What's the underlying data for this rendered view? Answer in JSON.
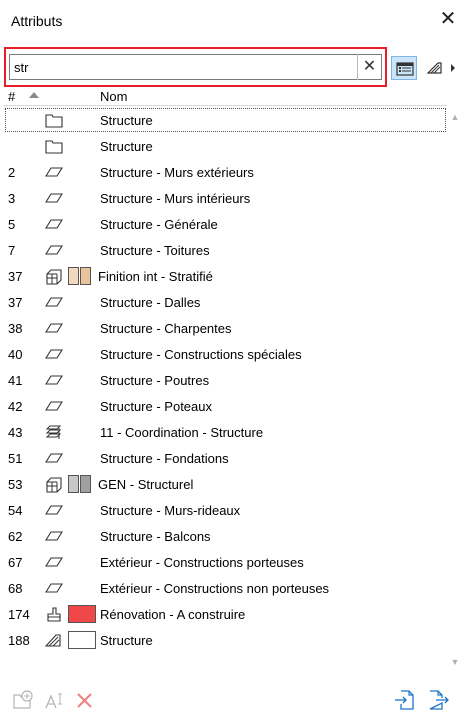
{
  "window": {
    "title": "Attributs",
    "close_icon": "close-icon"
  },
  "search": {
    "value": "str",
    "placeholder": "",
    "clear_icon": "clear-icon"
  },
  "toolbar": {
    "buttons": [
      {
        "icon": "list-view-icon",
        "active": true
      },
      {
        "icon": "attribute-type-icon",
        "active": false
      }
    ]
  },
  "header": {
    "num_label": "#",
    "name_label": "Nom",
    "sort": "ascending"
  },
  "rows": [
    {
      "num": "",
      "icon": "folder-icon",
      "name": "Structure",
      "selected": true
    },
    {
      "num": "",
      "icon": "folder-icon",
      "name": "Structure"
    },
    {
      "num": "2",
      "icon": "layer-icon",
      "name": "Structure - Murs extérieurs"
    },
    {
      "num": "3",
      "icon": "layer-icon",
      "name": "Structure - Murs intérieurs"
    },
    {
      "num": "5",
      "icon": "layer-icon",
      "name": "Structure - Générale"
    },
    {
      "num": "7",
      "icon": "layer-icon",
      "name": "Structure - Toitures"
    },
    {
      "num": "37",
      "icon": "composite-icon",
      "name": "Finition int - Stratifié",
      "swatches": [
        "#f2d9bd",
        "#e9c39b"
      ]
    },
    {
      "num": "37",
      "icon": "layer-icon",
      "name": "Structure - Dalles"
    },
    {
      "num": "38",
      "icon": "layer-icon",
      "name": "Structure - Charpentes"
    },
    {
      "num": "40",
      "icon": "layer-icon",
      "name": "Structure - Constructions spéciales"
    },
    {
      "num": "41",
      "icon": "layer-icon",
      "name": "Structure - Poutres"
    },
    {
      "num": "42",
      "icon": "layer-icon",
      "name": "Structure - Poteaux"
    },
    {
      "num": "43",
      "icon": "layer-combination-icon",
      "name": "11 - Coordination - Structure"
    },
    {
      "num": "51",
      "icon": "layer-icon",
      "name": "Structure - Fondations"
    },
    {
      "num": "53",
      "icon": "composite-icon",
      "name": "GEN - Structurel",
      "swatches": [
        "#c8c8c8",
        "#a0a0a0"
      ]
    },
    {
      "num": "54",
      "icon": "layer-icon",
      "name": "Structure - Murs-rideaux"
    },
    {
      "num": "62",
      "icon": "layer-icon",
      "name": "Structure - Balcons"
    },
    {
      "num": "67",
      "icon": "layer-icon",
      "name": "Extérieur - Constructions porteuses"
    },
    {
      "num": "68",
      "icon": "layer-icon",
      "name": "Extérieur - Constructions non porteuses"
    },
    {
      "num": "174",
      "icon": "renovation-filter-icon",
      "name": "Rénovation - A construire",
      "fill": "#f04848"
    },
    {
      "num": "188",
      "icon": "surface-icon",
      "name": "Structure",
      "fill": "#ffffff"
    }
  ],
  "footer": {
    "buttons": [
      {
        "icon": "new-folder-icon",
        "enabled": false
      },
      {
        "icon": "rename-icon",
        "enabled": false
      },
      {
        "icon": "delete-icon",
        "enabled": false
      },
      {
        "icon": "import-icon",
        "enabled": true
      },
      {
        "icon": "export-icon",
        "enabled": true
      }
    ]
  },
  "colors": {
    "search_highlight": "#e81f2a",
    "active_tool": "#cce4f7",
    "delete_icon": "#f08080",
    "disabled_icon": "#b5b5b5"
  }
}
